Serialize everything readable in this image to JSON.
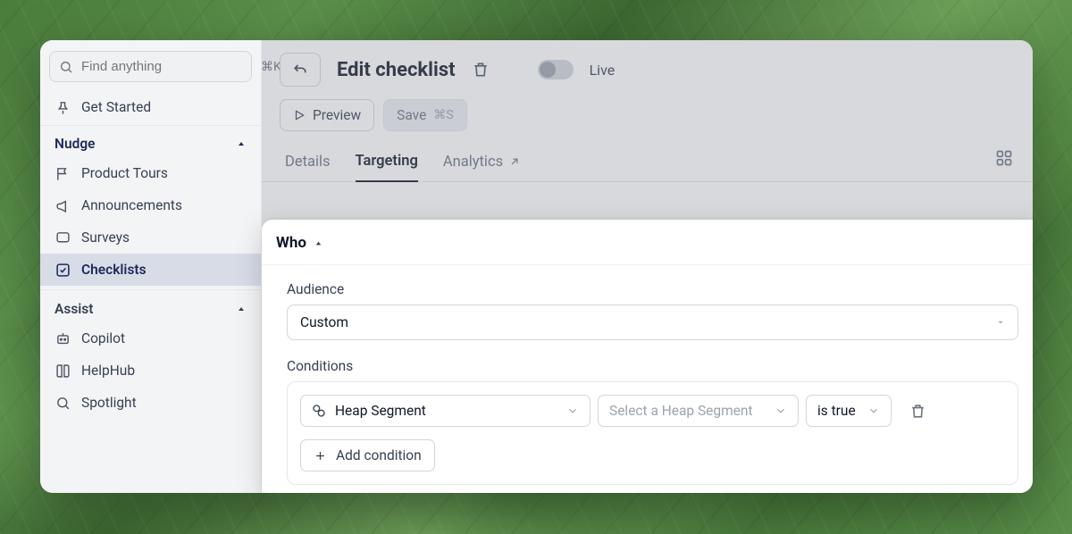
{
  "search": {
    "placeholder": "Find anything",
    "shortcut": "⌘K"
  },
  "sidebar": {
    "pinned": {
      "label": "Get Started"
    },
    "groups": [
      {
        "name": "Nudge",
        "items": [
          {
            "label": "Product Tours"
          },
          {
            "label": "Announcements"
          },
          {
            "label": "Surveys"
          },
          {
            "label": "Checklists",
            "active": true
          }
        ]
      },
      {
        "name": "Assist",
        "items": [
          {
            "label": "Copilot"
          },
          {
            "label": "HelpHub"
          },
          {
            "label": "Spotlight"
          }
        ]
      }
    ]
  },
  "header": {
    "title": "Edit checklist",
    "live_label": "Live"
  },
  "actions": {
    "preview": "Preview",
    "save": "Save",
    "save_shortcut": "⌘S"
  },
  "tabs": [
    "Details",
    "Targeting",
    "Analytics"
  ],
  "active_tab": "Targeting",
  "panel": {
    "title": "Who",
    "audience_label": "Audience",
    "audience_value": "Custom",
    "conditions_label": "Conditions",
    "condition_type": "Heap Segment",
    "condition_segment_placeholder": "Select a Heap Segment",
    "condition_operator": "is true",
    "add_condition": "Add condition"
  }
}
